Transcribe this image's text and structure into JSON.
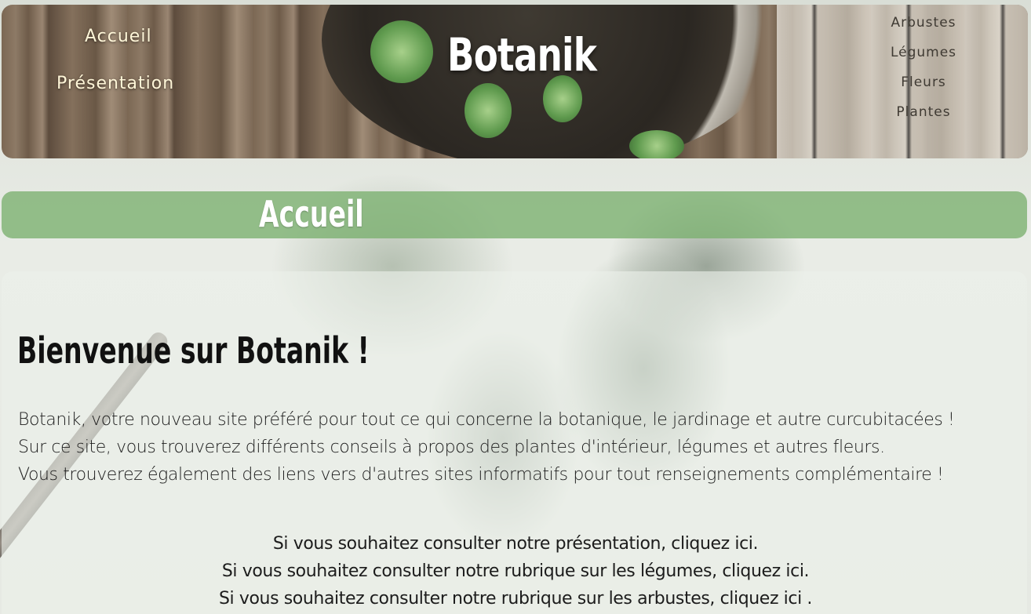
{
  "nav_left": {
    "items": [
      {
        "label": "Accueil"
      },
      {
        "label": "Présentation"
      }
    ]
  },
  "brand": {
    "title": "Botanik"
  },
  "nav_right": {
    "items": [
      {
        "label": "Arbustes"
      },
      {
        "label": "Légumes"
      },
      {
        "label": "Fleurs"
      },
      {
        "label": "Plantes"
      }
    ]
  },
  "page": {
    "title": "Accueil"
  },
  "content": {
    "heading": "Bienvenue sur Botanik !",
    "paragraphs": [
      "Botanik, votre nouveau site préféré pour tout ce qui concerne la botanique, le jardinage et autre curcubitacées !",
      "Sur ce site, vous trouverez différents conseils à propos des plantes d'intérieur, légumes et autres fleurs.",
      "Vous trouverez également des liens vers d'autres sites informatifs pour tout renseignements complémentaire !"
    ],
    "links": [
      {
        "prefix": "Si vous souhaitez consulter notre présentation, ",
        "link": "cliquez ici",
        "suffix": "."
      },
      {
        "prefix": "Si vous souhaitez consulter notre rubrique sur les légumes, ",
        "link": "cliquez ici",
        "suffix": "."
      },
      {
        "prefix": "Si vous souhaitez consulter notre rubrique sur les arbustes, ",
        "link": "cliquez ici",
        "suffix": " ."
      }
    ]
  },
  "colors": {
    "title_band": "#7aaf6e",
    "nav_left_text": "#fff6d8",
    "nav_right_text": "#3f3a33",
    "body_text": "#1c1c1c"
  }
}
